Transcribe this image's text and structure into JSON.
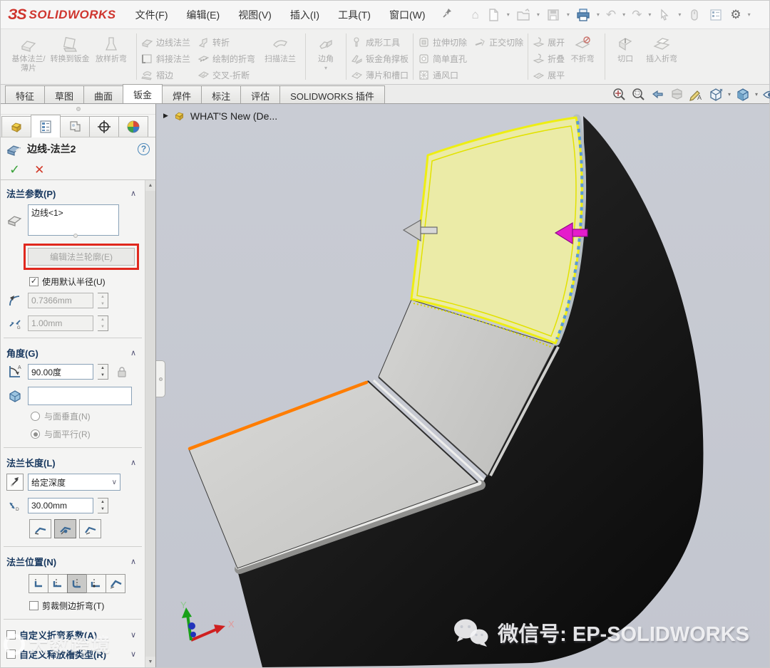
{
  "icons": {
    "check": "✓",
    "cancel": "✕",
    "help": "?",
    "chevron_up": "∧",
    "chevron_down": "∨",
    "menu_caret": "▾",
    "spin_up": "▲",
    "spin_down": "▼",
    "tree_expand": "▶",
    "home": "⌂",
    "undo": "↶",
    "redo": "↷",
    "gear": "⚙"
  },
  "colors": {
    "highlight_box_red": "#e0281e",
    "flange_preview_yellow": "#ececa4",
    "selected_edge_orange": "#ff7d00",
    "direction_arrow_magenta": "#e51ccb",
    "edge_dash_blue": "#5b9bd5",
    "viewport_background": "#c6c9d1"
  },
  "titlebar": {
    "logo": "SOLIDWORKS",
    "menus": [
      "文件(F)",
      "编辑(E)",
      "视图(V)",
      "插入(I)",
      "工具(T)",
      "窗口(W)"
    ]
  },
  "ribbon": {
    "base_flange": "基体法兰/薄片",
    "convert_to_sheetmetal": "转换到钣金",
    "lofted_bend": "放样折弯",
    "edge_flange": "边线法兰",
    "miter_flange": "斜接法兰",
    "hem": "褶边",
    "jog": "转折",
    "sketched_bend": "绘制的折弯",
    "cross_break": "交叉-折断",
    "swept_flange": "扫描法兰",
    "corner": "边角",
    "forming_tool": "成形工具",
    "gusset": "钣金角撑板",
    "tab_and_slot": "薄片和槽口",
    "extruded_cut": "拉伸切除",
    "normal_cut": "正交切除",
    "simple_hole": "简单直孔",
    "vent": "通风口",
    "unfold": "展开",
    "fold": "折叠",
    "flatten": "展平",
    "no_bends": "不折弯",
    "rip": "切口",
    "insert_bends": "插入折弯"
  },
  "tabs": {
    "items": [
      "特征",
      "草图",
      "曲面",
      "钣金",
      "焊件",
      "标注",
      "评估",
      "SOLIDWORKS 插件"
    ],
    "active": "钣金"
  },
  "property_manager": {
    "title": "边线-法兰2",
    "flange_params": {
      "title": "法兰参数(P)",
      "edge_selection": "边线<1>",
      "edit_profile_button": "编辑法兰轮廓(E)",
      "use_default_radius": "使用默认半径(U)",
      "bend_radius": "0.7366mm",
      "gap_distance": "1.00mm"
    },
    "angle": {
      "title": "角度(G)",
      "value": "90.00度",
      "perpendicular_to_face": "与面垂直(N)",
      "parallel_to_face": "与面平行(R)"
    },
    "flange_length": {
      "title": "法兰长度(L)",
      "end_condition": "给定深度",
      "value": "30.00mm"
    },
    "flange_position": {
      "title": "法兰位置(N)",
      "trim_side_bends": "剪裁侧边折弯(T)"
    },
    "custom_bend_allowance": "自定义折弯系数(A)",
    "custom_relief_type": "自定义释放槽类型(R)"
  },
  "viewport": {
    "feature_tree_item": "WHAT'S New  (De...",
    "axes": {
      "x": "X",
      "y": "Y"
    },
    "wechat_watermark": "微信号: EP-SOLIDWORKS",
    "brand_watermark": "大数跨境"
  }
}
